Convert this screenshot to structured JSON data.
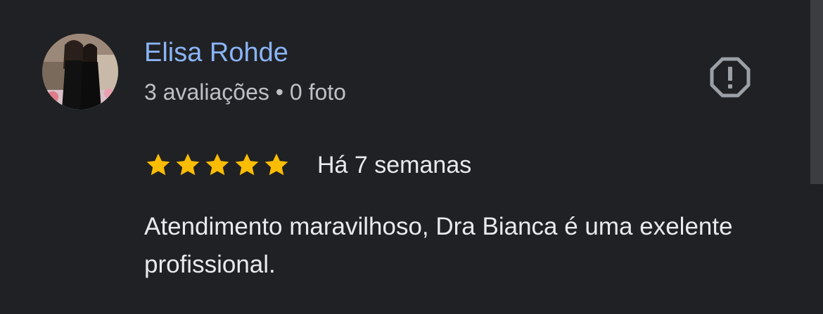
{
  "review": {
    "author_name": "Elisa Rohde",
    "author_stats": "3 avaliações • 0 foto",
    "rating": 5,
    "rating_max": 5,
    "date": "Há 7 semanas",
    "text": "Atendimento maravilhoso, Dra Bianca é uma exelente profissional.",
    "report_icon": "report-octagon-icon"
  },
  "colors": {
    "background": "#202124",
    "author_link": "#8ab4f8",
    "star": "#fbbc04",
    "secondary_text": "#bdc1c6",
    "primary_text": "#e8eaed",
    "icon": "#9aa0a6"
  }
}
